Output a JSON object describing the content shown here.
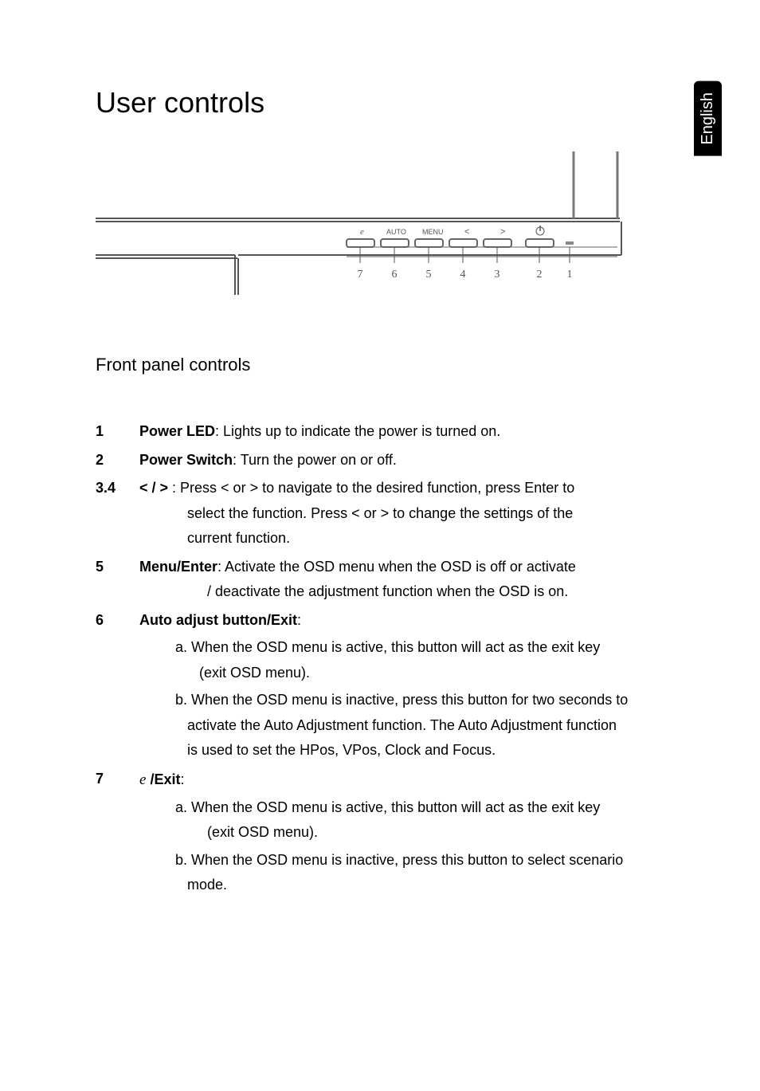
{
  "side_tab": "English",
  "page_title": "User controls",
  "section_title": "Front panel controls",
  "diagram": {
    "labels": {
      "b7": "e",
      "b6": "AUTO",
      "b5": "MENU",
      "b4": "<",
      "b3": ">",
      "b2_power_icon": "⏻"
    },
    "numbers": [
      "7",
      "6",
      "5",
      "4",
      "3",
      "2",
      "1"
    ]
  },
  "items": {
    "i1": {
      "num": "1",
      "term": "Power LED",
      "desc": ": Lights up to indicate the power is turned on."
    },
    "i2": {
      "num": "2",
      "term": "Power Switch",
      "desc": ": Turn the power on or off."
    },
    "i34": {
      "num": "3.4",
      "term": "< / >",
      "desc": " : Press < or > to navigate to the desired function, press Enter to",
      "cont1": "select the function. Press < or > to change the settings of the",
      "cont2": "current function."
    },
    "i5": {
      "num": "5",
      "term": "Menu/Enter",
      "desc": ": Activate the OSD menu when the OSD is off or activate",
      "cont1": "/ deactivate the adjustment function when the OSD is on."
    },
    "i6": {
      "num": "6",
      "term": "Auto adjust button/Exit",
      "colon": ":",
      "a1": "a. When the OSD menu is active, this button will act as the exit key",
      "a1cont": "(exit OSD menu).",
      "b1": "b. When the OSD menu is inactive, press this button for two seconds to",
      "b1cont1": "activate the Auto Adjustment function. The Auto Adjustment function",
      "b1cont2": "is used to set the HPos, VPos, Clock and Focus."
    },
    "i7": {
      "num": "7",
      "e_icon": "e",
      "term": " /Exit",
      "colon": ":",
      "a1": "a. When the OSD menu is active, this button will act as the exit key",
      "a1cont": "(exit OSD menu).",
      "b1": "b. When the OSD menu is inactive, press this button to select scenario",
      "b1cont": "mode."
    }
  }
}
